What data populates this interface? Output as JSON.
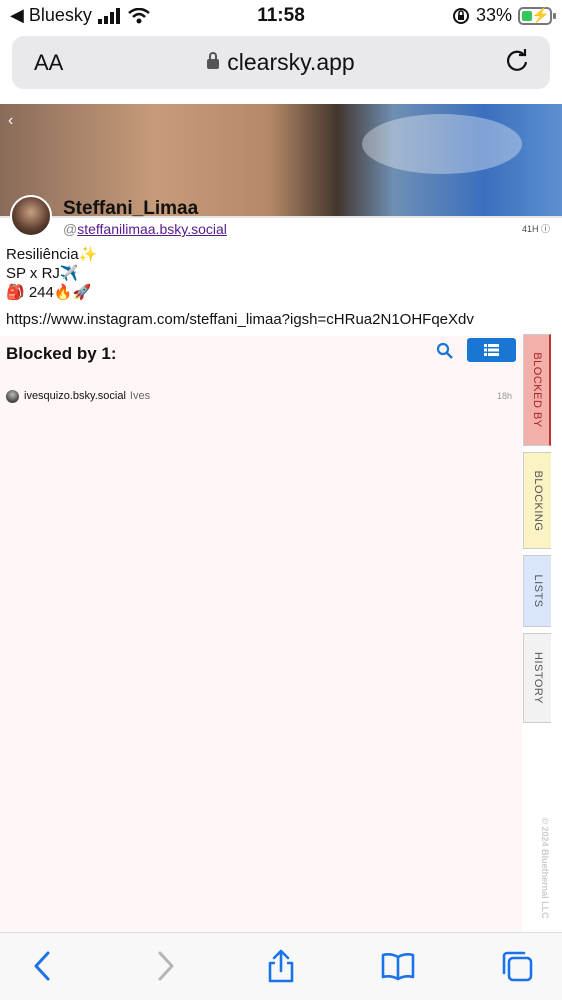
{
  "status": {
    "back_app": "◀ Bluesky",
    "time": "11:58",
    "battery": "33%"
  },
  "browser": {
    "text_size": "AA",
    "url": "clearsky.app"
  },
  "profile": {
    "display_name": "Steffani_Limaa",
    "handle_prefix": "@",
    "handle": "steffanilimaa.bsky.social",
    "timestamp": "41H",
    "bio_line1": "Resiliência✨",
    "bio_line2": "SP x RJ✈️",
    "bio_line3": "🎒 244🔥🚀",
    "link": "https://www.instagram.com/steffani_limaa?igsh=cHRua2N1OHFqeXdv"
  },
  "panel": {
    "title": "Blocked by 1:",
    "rows": [
      {
        "handle": "ivesquizo.bsky.social",
        "name": "Ives",
        "time": "18h"
      }
    ]
  },
  "tabs": {
    "blocked_by": "BLOCKED BY",
    "blocking": "BLOCKING",
    "lists": "LISTS",
    "history": "HISTORY"
  },
  "copyright": "© 2024 Bluethernal LLC",
  "colors": {
    "accent": "#1976d2",
    "blocked_tab": "#f3b0ab",
    "blocking_tab": "#fcf3c5",
    "lists_tab": "#d9e6fb"
  }
}
